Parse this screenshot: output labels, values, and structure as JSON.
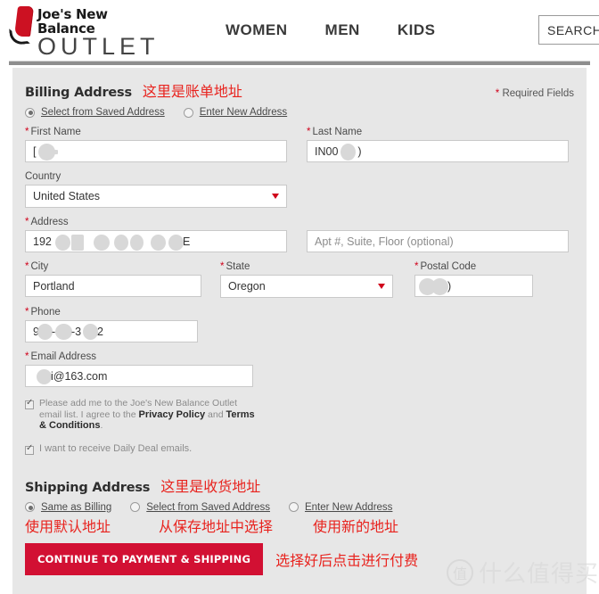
{
  "header": {
    "logo": {
      "top_text": "Joe's New Balance",
      "bottom_text": "OUTLET",
      "icon": "nb-swoosh-logo"
    },
    "nav": [
      {
        "label": "WOMEN"
      },
      {
        "label": "MEN"
      },
      {
        "label": "KIDS"
      }
    ],
    "search": {
      "label": "SEARCH",
      "placeholder": "SEARCH"
    }
  },
  "billing": {
    "title": "Billing Address",
    "annotation": "这里是账单地址",
    "required_note": "Required Fields",
    "required_asterisk": "*",
    "options": [
      {
        "label": "Select from Saved Address",
        "selected": true
      },
      {
        "label": "Enter New Address",
        "selected": false
      }
    ],
    "fields": {
      "first_name_label": "First Name",
      "first_name_value": "[",
      "last_name_label": "Last Name",
      "last_name_value": "IN00",
      "last_name_value_tail": ")",
      "country_label": "Country",
      "country_value": "United States",
      "address_label": "Address",
      "address_value": "192",
      "address_value_tail": "E",
      "apt_placeholder": "Apt #, Suite, Floor (optional)",
      "city_label": "City",
      "city_value": "Portland",
      "state_label": "State",
      "state_value": "Oregon",
      "postal_label": "Postal Code",
      "postal_value": ")",
      "phone_label": "Phone",
      "phone_value_a": "9",
      "phone_value_b": "-",
      "phone_value_c": "-3",
      "phone_value_d": "2",
      "email_label": "Email Address",
      "email_value": "i@163.com"
    },
    "consents": [
      {
        "checked": true,
        "text_a": "Please add me to the Joe's New Balance Outlet email list. I agree to the ",
        "link_a": "Privacy Policy",
        "text_b": " and ",
        "link_b": "Terms & Conditions",
        "text_c": "."
      },
      {
        "checked": true,
        "text_a": "I want to receive ",
        "link_a": "Daily Deal",
        "text_b": " emails."
      }
    ]
  },
  "shipping": {
    "title": "Shipping Address",
    "annotation": "这里是收货地址",
    "options": [
      {
        "label": "Same as Billing",
        "selected": true,
        "annotation": "使用默认地址"
      },
      {
        "label": "Select from Saved Address",
        "selected": false,
        "annotation": "从保存地址中选择"
      },
      {
        "label": "Enter New Address",
        "selected": false,
        "annotation": "使用新的地址"
      }
    ]
  },
  "cta": {
    "label": "CONTINUE TO PAYMENT & SHIPPING",
    "annotation": "选择好后点击进行付费"
  },
  "watermark": {
    "glyph": "值",
    "text": "什么值得买"
  },
  "colors": {
    "accent_red": "#d0021b",
    "cta_red": "#d21033",
    "annotation_red": "#e8231e",
    "panel_bg": "#e7e7e7",
    "rule_gray": "#8e8e8e"
  }
}
